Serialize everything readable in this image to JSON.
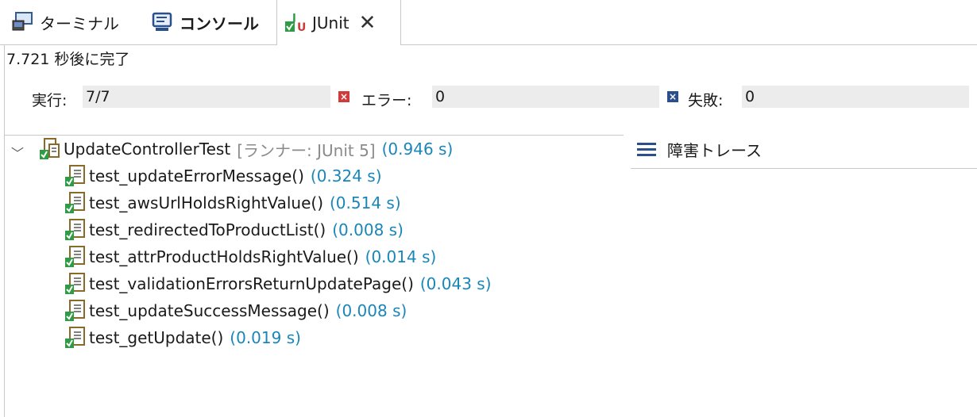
{
  "tabs": [
    {
      "label": "ターミナル",
      "icon": "terminal-icon"
    },
    {
      "label": "コンソール",
      "icon": "console-icon"
    },
    {
      "label": "JUnit",
      "icon": "junit-icon",
      "active": true
    }
  ],
  "status": "7.721 秒後に完了",
  "counters": {
    "runs_label": "実行:",
    "runs_value": "7/7",
    "errors_label": "エラー:",
    "errors_value": "0",
    "failures_label": "失敗:",
    "failures_value": "0"
  },
  "tree": {
    "root": {
      "name": "UpdateControllerTest",
      "runner": "[ランナー: JUnit 5]",
      "time": "(0.946 s)"
    },
    "tests": [
      {
        "name": "test_updateErrorMessage()",
        "time": "(0.324 s)"
      },
      {
        "name": "test_awsUrlHoldsRightValue()",
        "time": "(0.514 s)"
      },
      {
        "name": "test_redirectedToProductList()",
        "time": "(0.008 s)"
      },
      {
        "name": "test_attrProductHoldsRightValue()",
        "time": "(0.014 s)"
      },
      {
        "name": "test_validationErrorsReturnUpdatePage()",
        "time": "(0.043 s)"
      },
      {
        "name": "test_updateSuccessMessage()",
        "time": "(0.008 s)"
      },
      {
        "name": "test_getUpdate()",
        "time": "(0.019 s)"
      }
    ]
  },
  "trace": {
    "label": "障害トレース"
  },
  "colors": {
    "time": "#1a86b8",
    "error": "#d03a3a",
    "failure": "#2a4f8c",
    "pass": "#2e9b45"
  }
}
